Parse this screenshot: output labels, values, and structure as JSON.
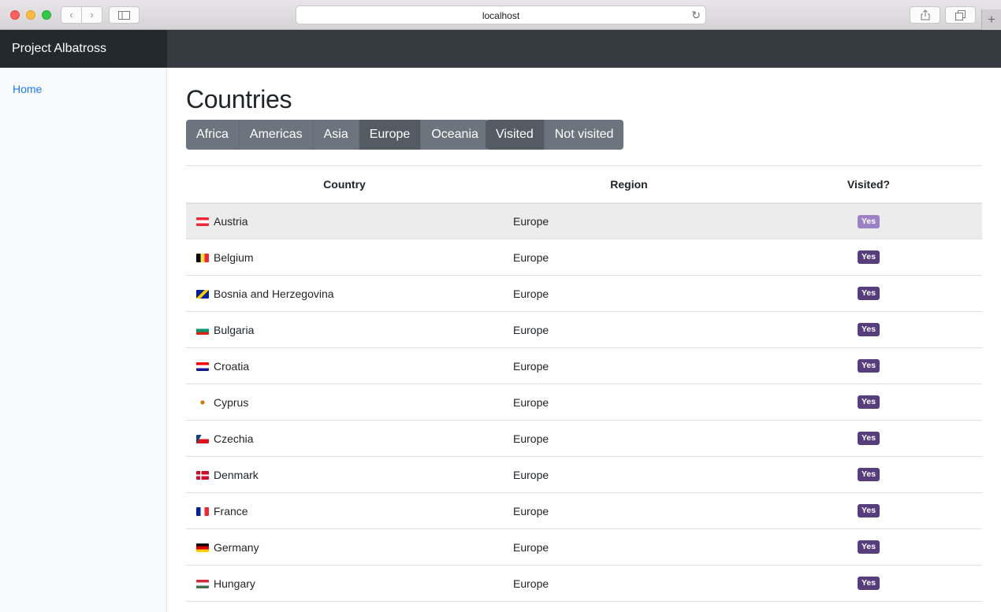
{
  "browser": {
    "url": "localhost",
    "back_icon": "chevron-left-icon",
    "forward_icon": "chevron-right-icon",
    "reload_icon": "reload-icon",
    "share_icon": "share-icon",
    "tabs_icon": "tabs-icon",
    "new_tab_label": "+"
  },
  "app": {
    "brand": "Project Albatross",
    "sidebar": {
      "items": [
        {
          "label": "Home"
        }
      ]
    }
  },
  "page": {
    "title": "Countries",
    "region_filters": [
      "Africa",
      "Americas",
      "Asia",
      "Europe",
      "Oceania"
    ],
    "active_region": "Europe",
    "visit_filters": [
      "Visited",
      "Not visited"
    ],
    "active_visit": "Visited"
  },
  "table": {
    "headers": [
      "Country",
      "Region",
      "Visited?"
    ],
    "rows": [
      {
        "country": "Austria",
        "region": "Europe",
        "visited": "Yes",
        "flag": "austria-flag-icon"
      },
      {
        "country": "Belgium",
        "region": "Europe",
        "visited": "Yes",
        "flag": "belgium-flag-icon"
      },
      {
        "country": "Bosnia and Herzegovina",
        "region": "Europe",
        "visited": "Yes",
        "flag": "bosnia-flag-icon"
      },
      {
        "country": "Bulgaria",
        "region": "Europe",
        "visited": "Yes",
        "flag": "bulgaria-flag-icon"
      },
      {
        "country": "Croatia",
        "region": "Europe",
        "visited": "Yes",
        "flag": "croatia-flag-icon"
      },
      {
        "country": "Cyprus",
        "region": "Europe",
        "visited": "Yes",
        "flag": "cyprus-flag-icon"
      },
      {
        "country": "Czechia",
        "region": "Europe",
        "visited": "Yes",
        "flag": "czechia-flag-icon"
      },
      {
        "country": "Denmark",
        "region": "Europe",
        "visited": "Yes",
        "flag": "denmark-flag-icon"
      },
      {
        "country": "France",
        "region": "Europe",
        "visited": "Yes",
        "flag": "france-flag-icon"
      },
      {
        "country": "Germany",
        "region": "Europe",
        "visited": "Yes",
        "flag": "germany-flag-icon"
      },
      {
        "country": "Hungary",
        "region": "Europe",
        "visited": "Yes",
        "flag": "hungary-flag-icon"
      }
    ]
  },
  "colors": {
    "navbar": "#343a40",
    "brand_bg": "#24292d",
    "link": "#1b7bf5",
    "button": "#6c757d",
    "button_active": "#545b62",
    "badge": "#563d7c",
    "row_hover": "#ececec"
  }
}
